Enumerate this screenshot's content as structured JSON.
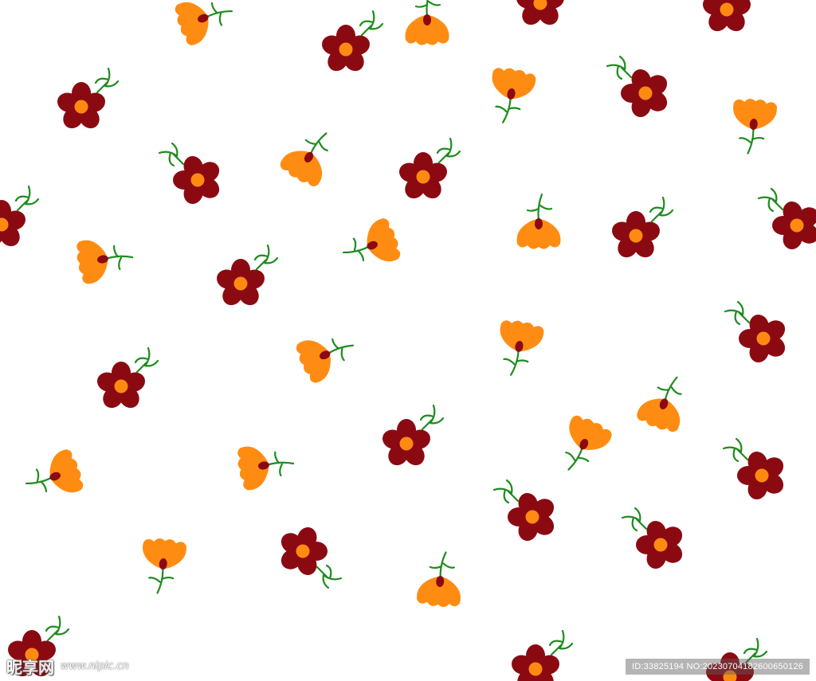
{
  "image": {
    "kind": "seamless floral pattern",
    "background": "#ffffff",
    "colors": {
      "red_flower": "#8b0a12",
      "flower_center": "#ff8a12",
      "orange_bud": "#ff8c12",
      "bud_base": "#8b0a12",
      "stem": "#1e8c1e"
    },
    "motifs": [
      "red-five-petal-flower",
      "orange-tulip-bud"
    ]
  },
  "watermark": {
    "logo_text": "昵享网",
    "site_text": "www.nipic.cn",
    "id_text": "ID:33825194 NO:20230704182600650126"
  }
}
